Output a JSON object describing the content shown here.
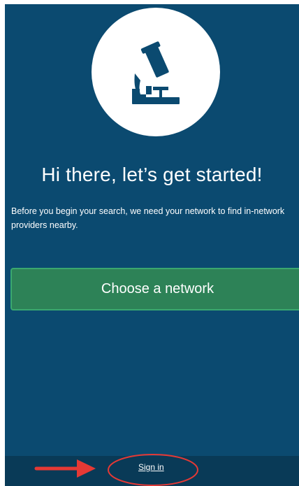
{
  "welcome": {
    "headline": "Hi there, let’s get started!",
    "description": "Before you begin your search, we need your network to find in-network providers nearby.",
    "cta_label": "Choose a network"
  },
  "footer": {
    "signin_label": "Sign in"
  },
  "icons": {
    "hero": "microscope-icon",
    "annotation_arrow": "arrow-right-icon"
  },
  "colors": {
    "background": "#0b4a70",
    "footer": "#093a57",
    "cta": "#2d8257",
    "cta_border": "#3aa86f",
    "icon": "#0b4a70",
    "annotation": "#e53935"
  }
}
